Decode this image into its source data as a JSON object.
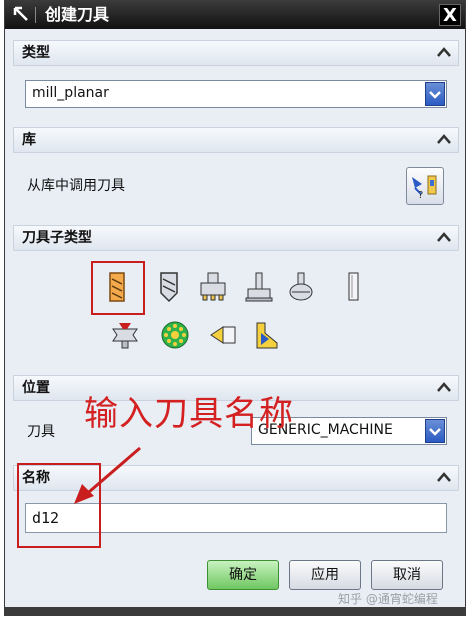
{
  "window": {
    "title": "创建刀具",
    "close_label": "X"
  },
  "type_section": {
    "label": "类型",
    "value": "mill_planar"
  },
  "library_section": {
    "label": "库",
    "text": "从库中调用刀具"
  },
  "subtype_section": {
    "label": "刀具子类型",
    "tools": [
      {
        "name": "mill-tool-icon",
        "selected": true
      },
      {
        "name": "chamfer-mill-tool-icon"
      },
      {
        "name": "t-cutter-tool-icon"
      },
      {
        "name": "barrel-tool-icon"
      },
      {
        "name": "ball-mill-tool-icon"
      },
      {
        "name": "drill-tool-icon"
      },
      {
        "name": "thread-mill-tool-icon"
      },
      {
        "name": "face-mill-tool-icon"
      },
      {
        "name": "probe-tool-icon"
      },
      {
        "name": "form-tool-icon"
      }
    ]
  },
  "location_section": {
    "label": "位置",
    "tool_label": "刀具",
    "tool_value": "GENERIC_MACHINE"
  },
  "name_section": {
    "label": "名称",
    "value": "d12"
  },
  "annotation": {
    "text": "输入刀具名称"
  },
  "buttons": {
    "ok": "确定",
    "apply": "应用",
    "cancel": "取消"
  },
  "watermark": "知乎 @通宵蛇编程",
  "colors": {
    "accent": "#2a5bc4",
    "annotation": "#d42020",
    "ok_button": "#6fc761"
  }
}
